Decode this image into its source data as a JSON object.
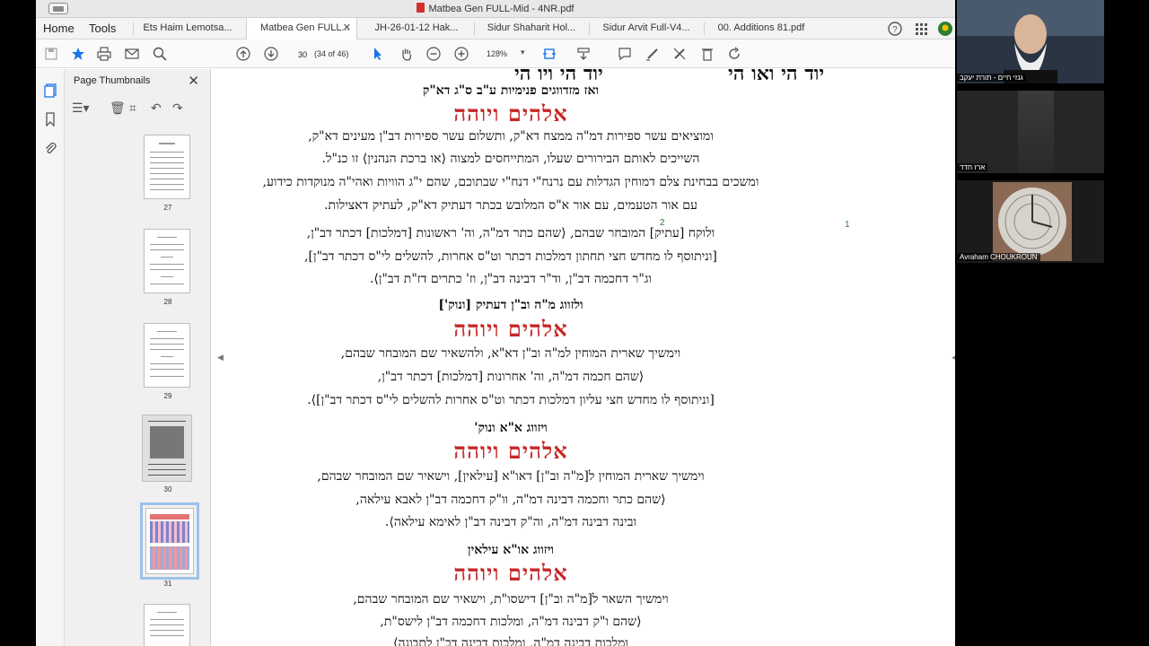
{
  "window": {
    "title": "Matbea Gen FULL-Mid - 4NR.pdf"
  },
  "menu": {
    "home": "Home",
    "tools": "Tools"
  },
  "tabs": [
    {
      "label": "Ets Haim Lemotsa..."
    },
    {
      "label": "Matbea Gen FULL...",
      "active": true
    },
    {
      "label": "JH-26-01-12 Hak..."
    },
    {
      "label": "Sidur Shaharit Hol..."
    },
    {
      "label": "Sidur Arvit Full-V4..."
    },
    {
      "label": "00. Additions 81.pdf"
    }
  ],
  "toolbar": {
    "page_number": "30",
    "page_count": "(34 of 46)",
    "zoom": "128%"
  },
  "thumbnails": {
    "panel_title": "Page Thumbnails",
    "pages": [
      "27",
      "28",
      "29",
      "30",
      "31"
    ],
    "selected_page": "31"
  },
  "document": {
    "top_left_heading": "יוד הי ויו הי",
    "top_right_heading": "יוד הי ואו הי",
    "divine_name": "אלהים ויוהה",
    "lines": [
      "ואז מזדווגים פנימיות ע\"ב ס\"ג דא\"ק",
      "ומוציאים עשר ספירות דמ\"ה ממצח דא\"ק, ותשלום עשר ספירות דב\"ן מעינים דא\"ק,",
      "השייכים לאותם הבירורים שעלו, המתייחסים למצוה ⟨או ברכת הנהנין⟩ זו כנ\"ל.",
      "ומשכים בבחינת צלם דמוחין הגדלות עם נרנח\"י דנח\"י שבתוכם, שהם י\"ג הוויות ואהי\"ה מנוקדות כידוע,",
      "עם אור הטעמים, עם אור א\"ס המלובש בכתר דעתיק דא\"ק, לעתיק דאצילות.",
      "ולוקח [עתיק] המובחר שבהם, ⟨שהם כתר דמ\"ה, וה' ראשונות [דמלכות] דכתר דב\"ן,",
      "[וניתוסף לו מחדש חצי תחתון דמלכות דכתר וט\"ס אחרות, להשלים לי\"ס דכתר דב\"ן],",
      "וג\"ר דחכמה דב\"ן, וד\"ר דבינה דב\"ן, וז' כתרים דז\"ת דב\"ן⟩.",
      "ולזווג מ\"ה וב\"ן דעתיק [ונוק']",
      "וימשיך שארית המוחין למ\"ה וב\"ן דא\"א, ולהשאיר שם המובחר שבהם,",
      "⟨שהם חכמה דמ\"ה, וה' אחרונות [דמלכות] דכתר דב\"ן,",
      "[וניתוסף לו מחדש חצי עליון דמלכות דכתר וט\"ס אחרות להשלים לי\"ס דכתר דב\"ן]⟩.",
      "ויזווג א\"א ונוק'",
      "וימשיך שארית המוחין ל[מ\"ה וב\"ן] דאו\"א [עילאין], וישאיר שם המובחר שבהם,",
      "⟨שהם כתר וחכמה דבינה דמ\"ה, וו\"ק דחכמה דב\"ן לאבא עילאה,",
      "ובינה דבינה דמ\"ה, וה\"ק דבינה דב\"ן לאימא עילאה⟩.",
      "ויזווג או\"א עילאין",
      "וימשיך השאר ל[מ\"ה וב\"ן] דישסו\"ת, וישאיר שם המובחר שבהם,",
      "⟨שהם ו\"ק דבינה דמ\"ה, ומלכות דחכמה דב\"ן לישס\"ת,",
      "ומלכות דבינה דמ\"ה, ומלכות דבינה דב\"ן לתבונה⟩"
    ],
    "footnote_marks": [
      "1",
      "2"
    ]
  },
  "participants": [
    {
      "name": "גנזי חיים - תורת יעקב"
    },
    {
      "name": "ארז חדד"
    },
    {
      "name": "Avraham CHOUKROUN"
    }
  ],
  "colors": {
    "name_red": "#c62828",
    "name_blue": "#1f3a8a",
    "selected_thumb": "#9cc1ea",
    "star": "#1a73e8"
  }
}
